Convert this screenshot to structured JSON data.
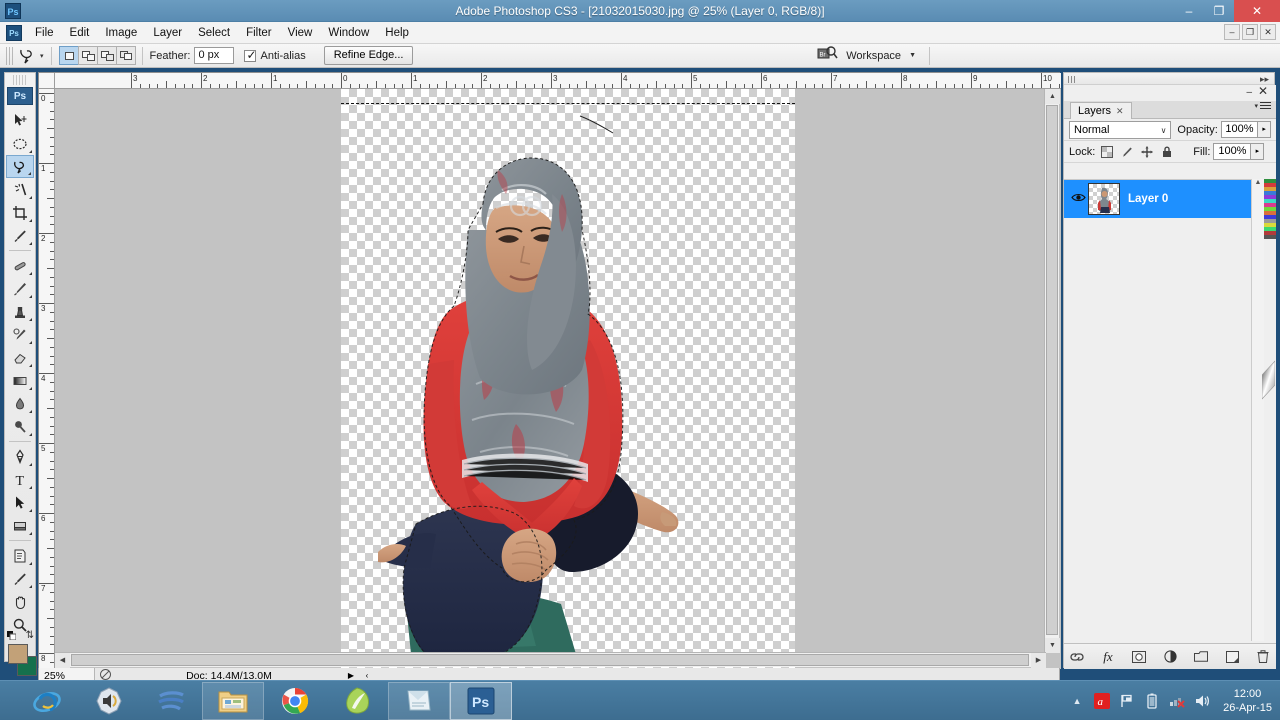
{
  "window": {
    "title": "Adobe Photoshop CS3 - [21032015030.jpg @ 25% (Layer 0, RGB/8)]",
    "app_badge": "Ps",
    "minimize": "–",
    "restore": "❐",
    "close": "✕",
    "doc_minimize": "–",
    "doc_restore": "❐",
    "doc_close": "✕"
  },
  "menubar": {
    "app_icon": "Ps",
    "items": [
      {
        "label": "File"
      },
      {
        "label": "Edit"
      },
      {
        "label": "Image"
      },
      {
        "label": "Layer"
      },
      {
        "label": "Select"
      },
      {
        "label": "Filter"
      },
      {
        "label": "View"
      },
      {
        "label": "Window"
      },
      {
        "label": "Help"
      }
    ]
  },
  "options_bar": {
    "tool_icon": "lasso-tool-icon",
    "tool_preset_caret": "▾",
    "selection_modes": [
      {
        "name": "new-selection",
        "active": true
      },
      {
        "name": "add-to-selection",
        "active": false
      },
      {
        "name": "subtract-from-selection",
        "active": false
      },
      {
        "name": "intersect-with-selection",
        "active": false
      }
    ],
    "feather_label": "Feather:",
    "feather_value": "0 px",
    "antialias_label": "Anti-alias",
    "antialias_checked": true,
    "refine_edge_label": "Refine Edge...",
    "workspace_label": "Workspace",
    "workspace_caret": "▼"
  },
  "tools": [
    {
      "name": "move-tool",
      "icon": "move-icon",
      "active": false,
      "has_flyout": false
    },
    {
      "name": "marquee-tool",
      "icon": "ellipse-marquee-icon",
      "active": false,
      "has_flyout": true
    },
    {
      "name": "lasso-tool",
      "icon": "lasso-icon",
      "active": true,
      "has_flyout": true
    },
    {
      "name": "magic-wand-tool",
      "icon": "magic-wand-icon",
      "active": false,
      "has_flyout": true
    },
    {
      "name": "crop-tool",
      "icon": "crop-icon",
      "active": false,
      "has_flyout": true
    },
    {
      "name": "eyedropper-tool",
      "icon": "eyedropper-icon",
      "active": false,
      "has_flyout": true
    },
    {
      "name": "healing-brush-tool",
      "icon": "healing-brush-icon",
      "active": false,
      "has_flyout": true
    },
    {
      "name": "brush-tool",
      "icon": "brush-icon",
      "active": false,
      "has_flyout": true
    },
    {
      "name": "clone-stamp-tool",
      "icon": "clone-stamp-icon",
      "active": false,
      "has_flyout": true
    },
    {
      "name": "history-brush-tool",
      "icon": "history-brush-icon",
      "active": false,
      "has_flyout": true
    },
    {
      "name": "eraser-tool",
      "icon": "eraser-icon",
      "active": false,
      "has_flyout": true
    },
    {
      "name": "gradient-tool",
      "icon": "gradient-icon",
      "active": false,
      "has_flyout": true
    },
    {
      "name": "blur-tool",
      "icon": "blur-drop-icon",
      "active": false,
      "has_flyout": true
    },
    {
      "name": "dodge-tool",
      "icon": "dodge-icon",
      "active": false,
      "has_flyout": true
    },
    {
      "name": "pen-tool",
      "icon": "pen-icon",
      "active": false,
      "has_flyout": true
    },
    {
      "name": "type-tool",
      "icon": "type-icon",
      "active": false,
      "has_flyout": true
    },
    {
      "name": "path-selection-tool",
      "icon": "path-arrow-icon",
      "active": false,
      "has_flyout": true
    },
    {
      "name": "rectangle-shape-tool",
      "icon": "rectangle-icon",
      "active": false,
      "has_flyout": true
    },
    {
      "name": "notes-tool",
      "icon": "notes-icon",
      "active": false,
      "has_flyout": true
    },
    {
      "name": "eyedropper-tool-2",
      "icon": "eyedropper-icon",
      "active": false,
      "has_flyout": true
    },
    {
      "name": "hand-tool",
      "icon": "hand-icon",
      "active": false,
      "has_flyout": false
    },
    {
      "name": "zoom-tool",
      "icon": "magnifier-icon",
      "active": false,
      "has_flyout": false
    }
  ],
  "color_swatches": {
    "foreground": "#c2a178",
    "background": "#15704d",
    "swap_icon": "swap-colors-icon",
    "default_icon": "default-colors-icon",
    "quickmask_icon": "quick-mask-icon"
  },
  "rulers": {
    "unit": "inches",
    "horizontal_ticks": [
      "3",
      "2",
      "1",
      "0",
      "1",
      "2",
      "3",
      "4",
      "5",
      "6",
      "7",
      "8",
      "9",
      "10"
    ],
    "vertical_ticks": [
      "0",
      "1",
      "2",
      "3",
      "4",
      "5",
      "6",
      "7",
      "8"
    ]
  },
  "canvas": {
    "zoom": "25%",
    "transparency": "checkerboard",
    "selection_active": true
  },
  "status_bar": {
    "zoom": "25%",
    "lens_icon": "preview-icon",
    "doc_info": "Doc: 14.4M/13.0M",
    "expand_arrow": "▶",
    "left_arrow": "‹"
  },
  "layers_panel": {
    "tab_label": "Layers",
    "tab_close": "✕",
    "minimize": "–",
    "close": "✕",
    "menu_icon": "panel-menu-icon",
    "blend_mode": "Normal",
    "blend_caret": "∨",
    "opacity_label": "Opacity:",
    "opacity_value": "100%",
    "opacity_caret": "▸",
    "lock_label": "Lock:",
    "lock_icons": [
      {
        "name": "lock-transparent-pixels-icon"
      },
      {
        "name": "lock-image-pixels-icon"
      },
      {
        "name": "lock-position-icon"
      },
      {
        "name": "lock-all-icon"
      }
    ],
    "fill_label": "Fill:",
    "fill_value": "100%",
    "fill_caret": "▸",
    "layers": [
      {
        "name": "Layer 0",
        "visible": true,
        "selected": true
      }
    ],
    "bottom_icons": [
      {
        "name": "link-layers-icon",
        "glyph": "⛓"
      },
      {
        "name": "layer-style-fx-icon",
        "glyph": "fx"
      },
      {
        "name": "add-layer-mask-icon",
        "glyph": "◻"
      },
      {
        "name": "new-adjustment-layer-icon",
        "glyph": "◐"
      },
      {
        "name": "new-group-icon",
        "glyph": "▭"
      },
      {
        "name": "new-layer-icon",
        "glyph": "▣"
      },
      {
        "name": "delete-layer-icon",
        "glyph": "🗑"
      }
    ]
  },
  "taskbar": {
    "items": [
      {
        "name": "internet-explorer-button",
        "icon": "ie-icon",
        "framed": false,
        "active": false
      },
      {
        "name": "media-player-button",
        "icon": "media-player-icon",
        "framed": false,
        "active": false
      },
      {
        "name": "blue-app-button",
        "icon": "blue-lines-icon",
        "framed": false,
        "active": false
      },
      {
        "name": "file-explorer-button",
        "icon": "folder-icon",
        "framed": true,
        "active": false
      },
      {
        "name": "chrome-button",
        "icon": "chrome-icon",
        "framed": false,
        "active": false
      },
      {
        "name": "green-app-button",
        "icon": "green-leaf-icon",
        "framed": false,
        "active": false
      },
      {
        "name": "notepad-button",
        "icon": "notepad-icon",
        "framed": true,
        "active": false
      },
      {
        "name": "photoshop-button",
        "icon": "photoshop-icon",
        "framed": false,
        "active": true
      }
    ],
    "tray": {
      "show_hidden": "▲",
      "icons": [
        {
          "name": "avira-icon",
          "glyph": "α"
        },
        {
          "name": "flag-action-center-icon",
          "glyph": "⚑"
        },
        {
          "name": "battery-icon",
          "glyph": "▯"
        },
        {
          "name": "network-disconnected-icon",
          "glyph": "▰"
        },
        {
          "name": "volume-icon",
          "glyph": "🔊"
        }
      ],
      "time": "12:00",
      "date": "26-Apr-15"
    }
  }
}
